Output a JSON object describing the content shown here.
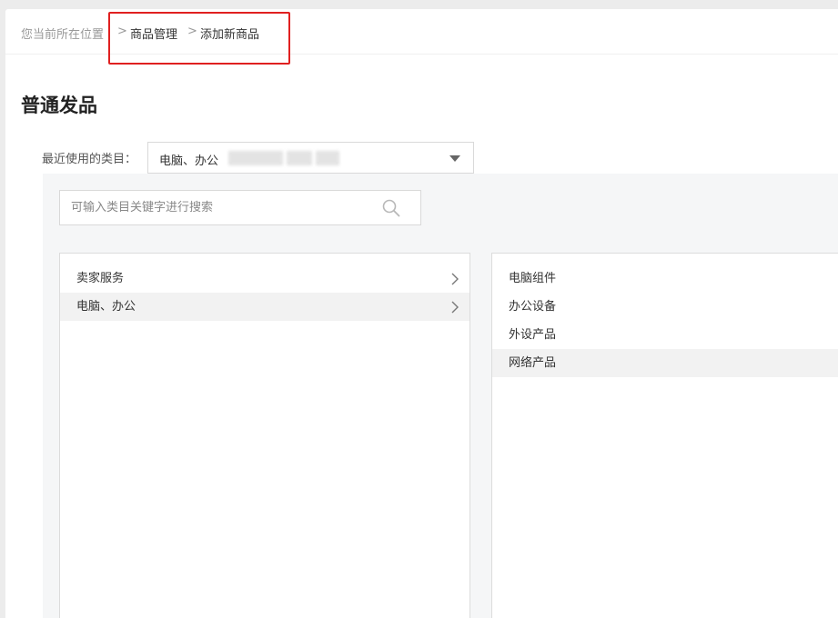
{
  "breadcrumb": {
    "prefix": "您当前所在位置",
    "separator": ">",
    "parent": "商品管理",
    "current": "添加新商品"
  },
  "page_title": "普通发品",
  "recent": {
    "label": "最近使用的类目：",
    "value": "电脑、办公"
  },
  "search": {
    "placeholder": "可输入类目关键字进行搜索"
  },
  "level1": {
    "items": [
      {
        "label": "卖家服务",
        "selected": false
      },
      {
        "label": "电脑、办公",
        "selected": true
      }
    ]
  },
  "level2": {
    "items": [
      {
        "label": "电脑组件",
        "selected": false
      },
      {
        "label": "办公设备",
        "selected": false
      },
      {
        "label": "外设产品",
        "selected": false
      },
      {
        "label": "网络产品",
        "selected": true
      }
    ]
  },
  "colors": {
    "highlight": "#e02020",
    "panel_bg": "#f5f6f7",
    "selected_row": "#f2f2f2"
  }
}
